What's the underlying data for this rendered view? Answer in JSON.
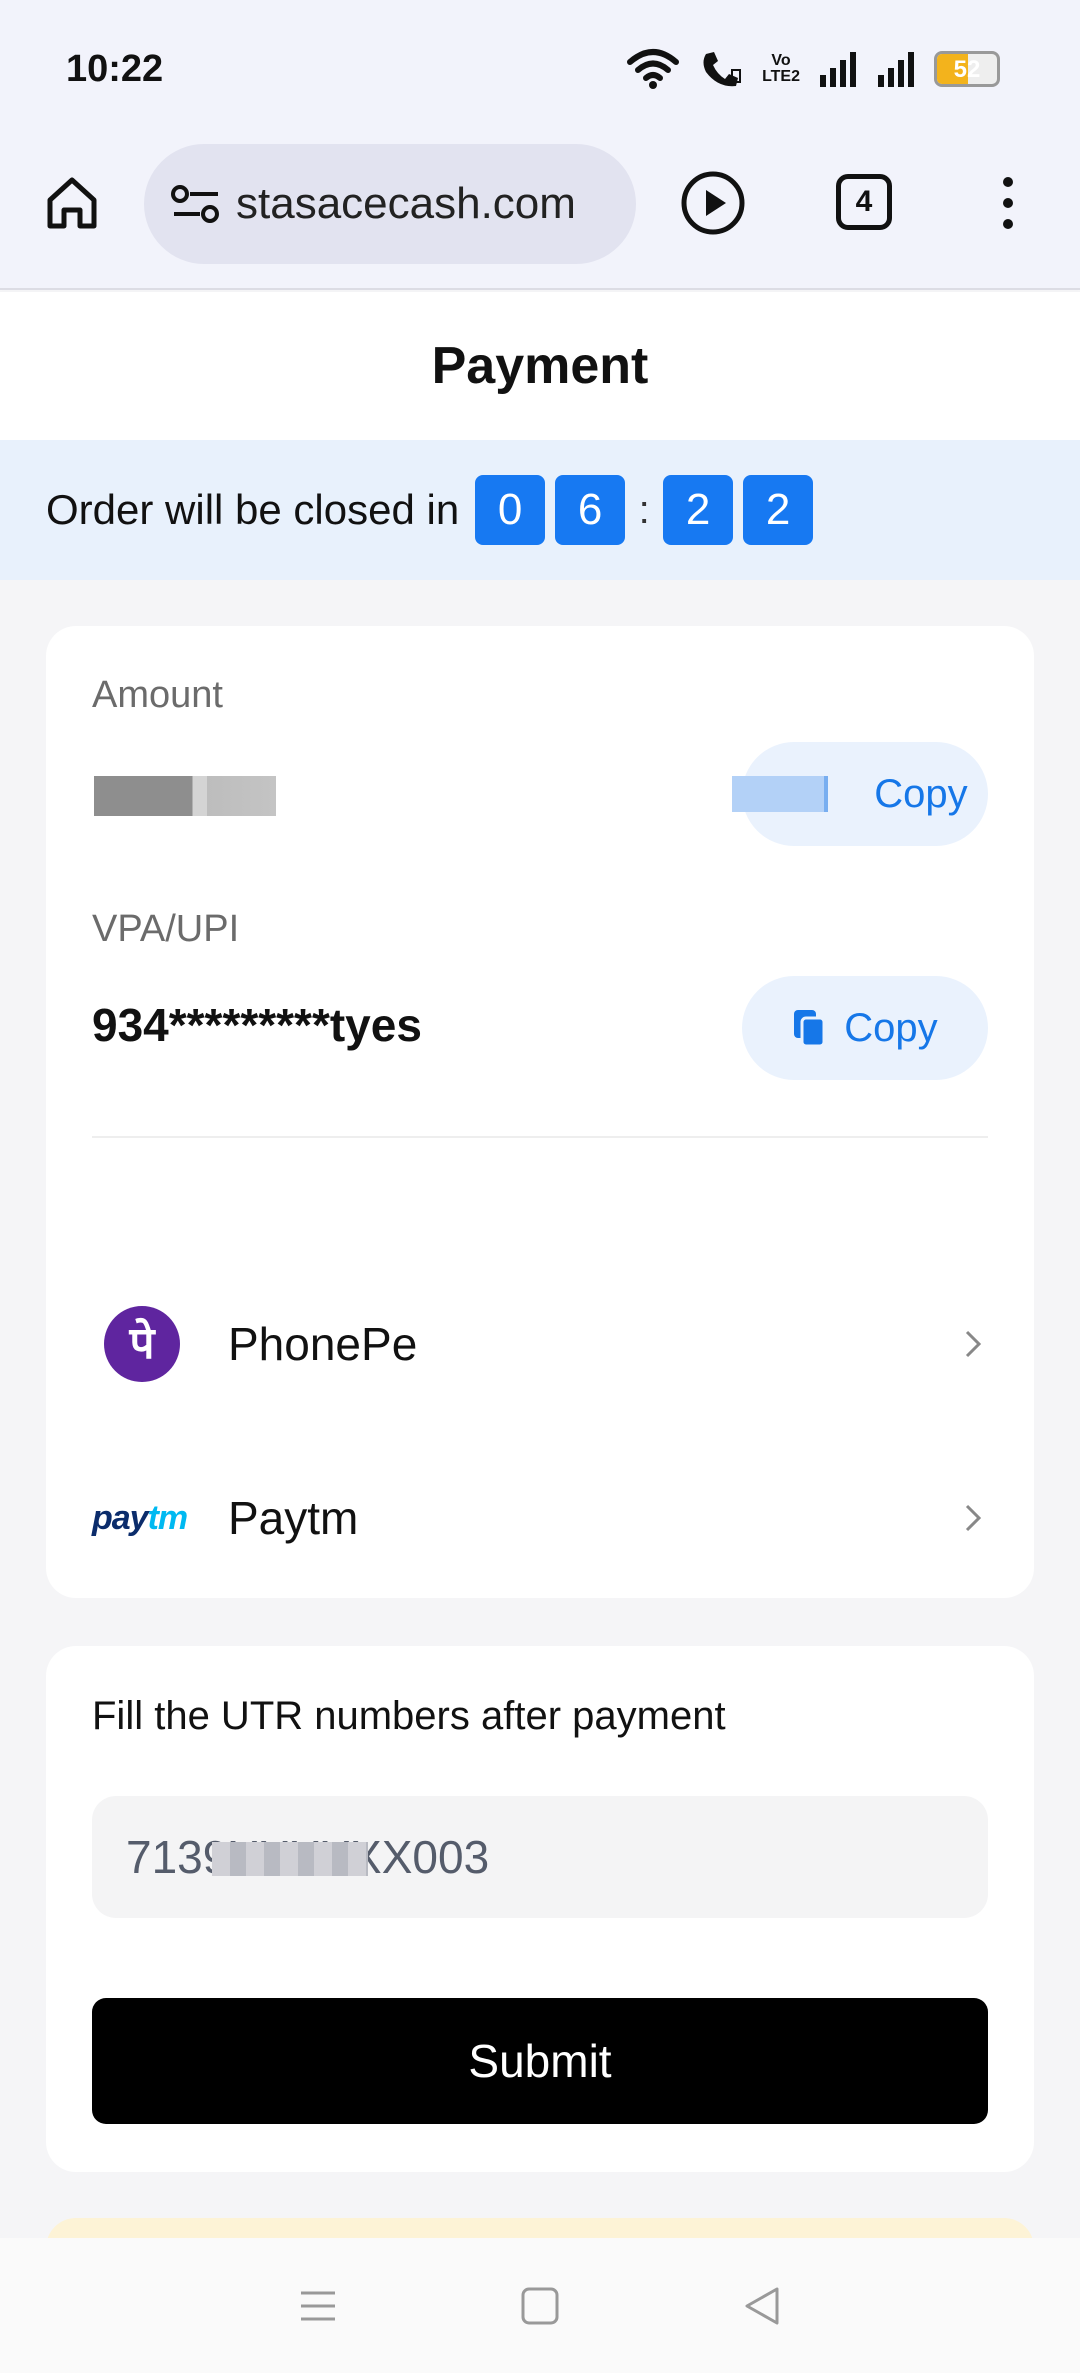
{
  "status_bar": {
    "time": "10:22",
    "volte_line1": "Vo",
    "volte_line2": "LTE2",
    "battery": "52",
    "battery_level": 0.52,
    "battery_color": "#f3b31c"
  },
  "browser": {
    "url": "stasacecash.com",
    "tab_count": "4"
  },
  "page": {
    "title": "Payment"
  },
  "countdown": {
    "label": "Order will be closed in",
    "digits": [
      "0",
      "6",
      "2",
      "2"
    ],
    "separator": ":",
    "accent_color": "#1779f2"
  },
  "payment_card": {
    "amount_label": "Amount",
    "copy_label": "Copy",
    "vpa_label": "VPA/UPI",
    "vpa_value": "934*********tyes",
    "apps": [
      {
        "name": "PhonePe",
        "icon": "phonepe-logo",
        "logo_text": "पे"
      },
      {
        "name": "Paytm",
        "icon": "paytm-logo",
        "logo_text_1": "pay",
        "logo_text_2": "tm"
      }
    ]
  },
  "utr_card": {
    "label": "Fill the UTR numbers after payment",
    "input_value": "7139XXXXXX003",
    "submit_label": "Submit"
  }
}
